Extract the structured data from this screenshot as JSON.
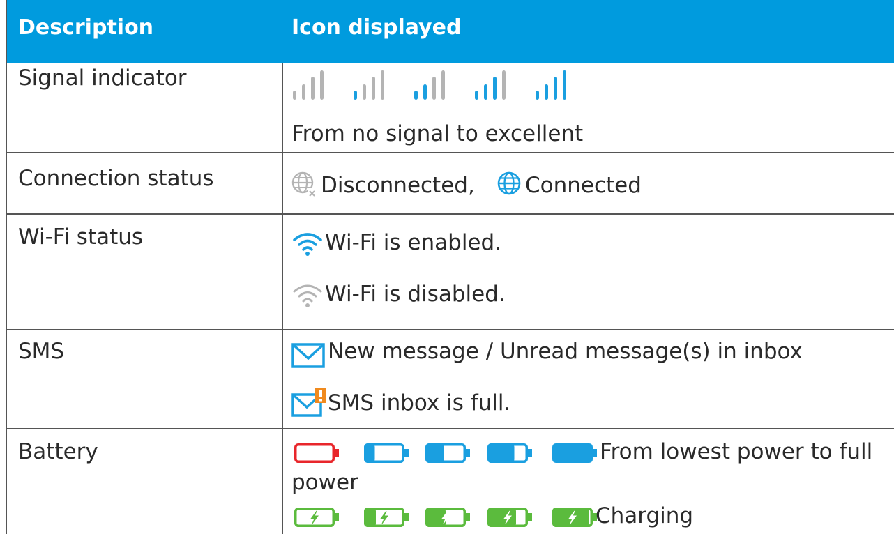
{
  "table": {
    "headers": {
      "description": "Description",
      "icon": "Icon displayed"
    },
    "rows": {
      "signal": {
        "label": "Signal indicator",
        "caption": "From no signal to excellent",
        "bars_lit": [
          0,
          1,
          2,
          3,
          4
        ]
      },
      "connection": {
        "label": "Connection status",
        "disconnected": "Disconnected,",
        "connected": "Connected"
      },
      "wifi": {
        "label": "Wi-Fi status",
        "enabled": "Wi-Fi is enabled.",
        "disabled": "Wi-Fi is disabled."
      },
      "sms": {
        "label": "SMS",
        "new_message": "New message / Unread message(s) in inbox",
        "full": "SMS inbox is full."
      },
      "battery": {
        "label": "Battery",
        "levels_line1": "From lowest power to full",
        "levels_line2": "power",
        "charging": "Charging",
        "levels": [
          0,
          0.25,
          0.5,
          0.75,
          1
        ]
      }
    }
  },
  "colors": {
    "header_bg": "#009bde",
    "accent_blue": "#1a9fe0",
    "inactive_grey": "#b4b4b4",
    "low_battery_red": "#e8262b",
    "charging_green": "#5bbb3d",
    "warning_orange": "#f08a1e",
    "rule_grey": "#555555"
  },
  "icons": [
    "signal-bars-icon",
    "globe-disconnected-icon",
    "globe-connected-icon",
    "wifi-enabled-icon",
    "wifi-disabled-icon",
    "mail-icon",
    "mail-full-icon",
    "battery-icon",
    "battery-charging-icon"
  ]
}
